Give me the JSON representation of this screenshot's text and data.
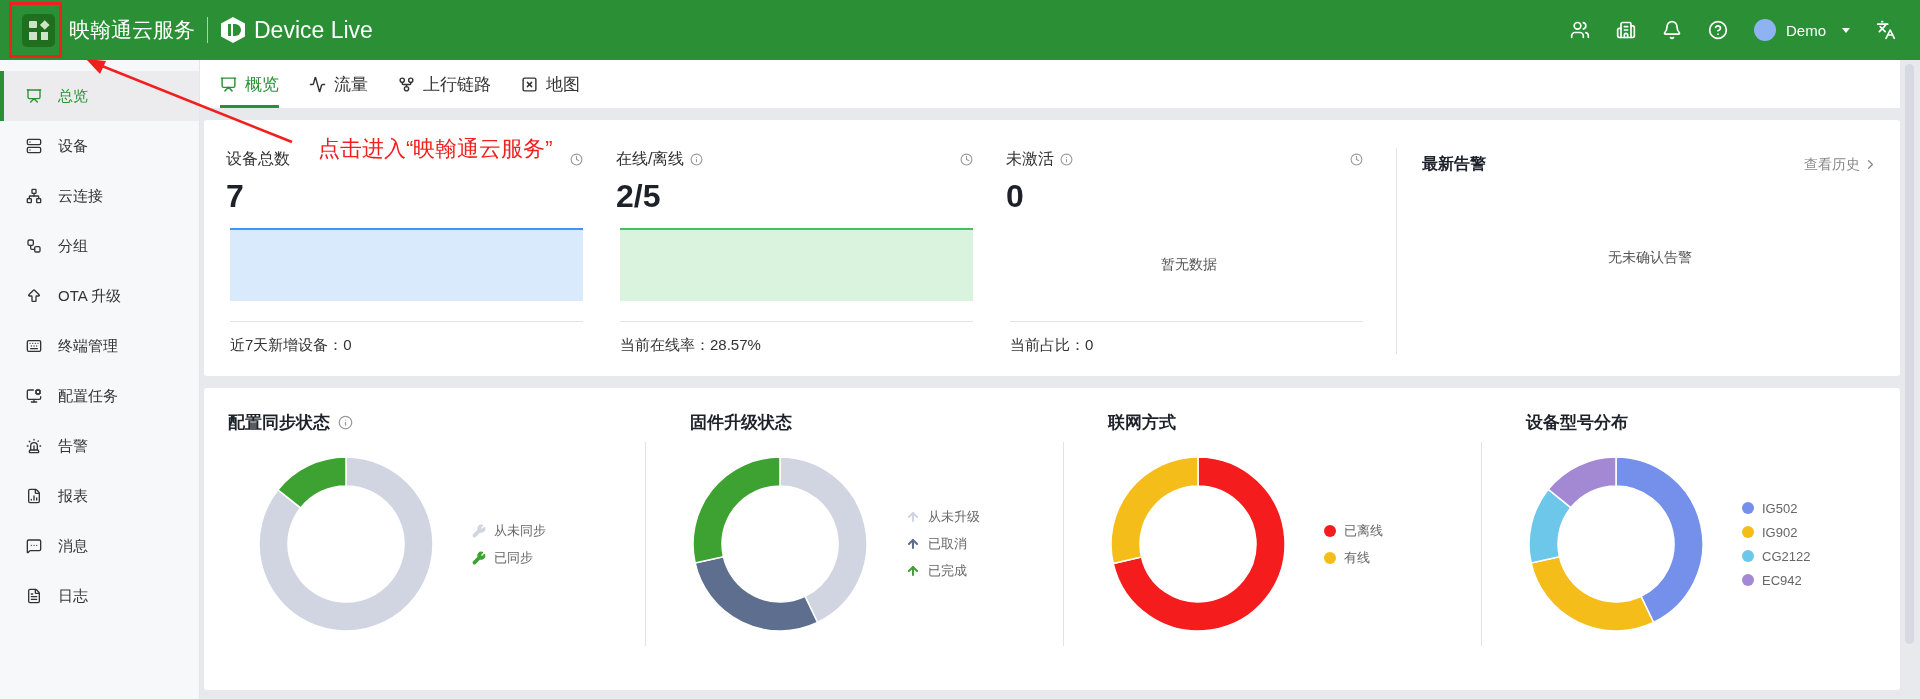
{
  "header": {
    "product": "映翰通云服务",
    "app": "Device Live",
    "user": "Demo"
  },
  "sidebar": {
    "items": [
      {
        "label": "总览",
        "selected": true
      },
      {
        "label": "设备",
        "selected": false
      },
      {
        "label": "云连接",
        "selected": false
      },
      {
        "label": "分组",
        "selected": false
      },
      {
        "label": "OTA 升级",
        "selected": false
      },
      {
        "label": "终端管理",
        "selected": false
      },
      {
        "label": "配置任务",
        "selected": false
      },
      {
        "label": "告警",
        "selected": false
      },
      {
        "label": "报表",
        "selected": false
      },
      {
        "label": "消息",
        "selected": false
      },
      {
        "label": "日志",
        "selected": false
      }
    ]
  },
  "tabs": [
    {
      "label": "概览",
      "selected": true
    },
    {
      "label": "流量",
      "selected": false
    },
    {
      "label": "上行链路",
      "selected": false
    },
    {
      "label": "地图",
      "selected": false
    }
  ],
  "stats": [
    {
      "kind": "area",
      "title": "设备总数",
      "info": false,
      "value": "7",
      "color": "#3d96f2",
      "footer": "近7天新增设备：0"
    },
    {
      "kind": "area",
      "title": "在线/离线",
      "info": true,
      "value": "2/5",
      "color": "#45c15a",
      "footer": "当前在线率：28.57%"
    },
    {
      "kind": "empty",
      "title": "未激活",
      "info": true,
      "value": "0",
      "empty_text": "暂无数据",
      "footer": "当前占比：0"
    }
  ],
  "alerts": {
    "title": "最新告警",
    "link": "查看历史",
    "empty_text": "无未确认告警"
  },
  "charts": [
    {
      "title": "配置同步状态",
      "info": true,
      "kind": "wrench",
      "legend": [
        {
          "color": "#d0d5e1"
        },
        {
          "color": "#3da232"
        }
      ],
      "chart_data": {
        "type": "donut",
        "categories": [
          "从未同步",
          "已同步"
        ],
        "values": [
          85.7,
          14.3
        ]
      }
    },
    {
      "title": "固件升级状态",
      "info": false,
      "kind": "arrow",
      "legend": [
        {
          "color": "#d0d5e1"
        },
        {
          "color": "#5d6e8f"
        },
        {
          "color": "#3da232"
        }
      ],
      "chart_data": {
        "type": "donut",
        "categories": [
          "从未升级",
          "已取消",
          "已完成"
        ],
        "values": [
          42.9,
          28.6,
          28.5
        ]
      }
    },
    {
      "title": "联网方式",
      "info": false,
      "kind": "dot",
      "legend": [
        {
          "color": "#f41c1c"
        },
        {
          "color": "#f5bd19"
        }
      ],
      "chart_data": {
        "type": "donut",
        "categories": [
          "已离线",
          "有线"
        ],
        "values": [
          71.4,
          28.6
        ]
      }
    },
    {
      "title": "设备型号分布",
      "info": false,
      "kind": "dot",
      "legend": [
        {
          "color": "#7590ea"
        },
        {
          "color": "#f5bd19"
        },
        {
          "color": "#6cc7ea"
        },
        {
          "color": "#a389d4"
        }
      ],
      "chart_data": {
        "type": "donut",
        "categories": [
          "IG502",
          "IG902",
          "CG2122",
          "EC942"
        ],
        "values": [
          42.9,
          28.6,
          14.3,
          14.2
        ]
      }
    }
  ],
  "annotation": {
    "text": "点击进入“映翰通云服务”"
  }
}
